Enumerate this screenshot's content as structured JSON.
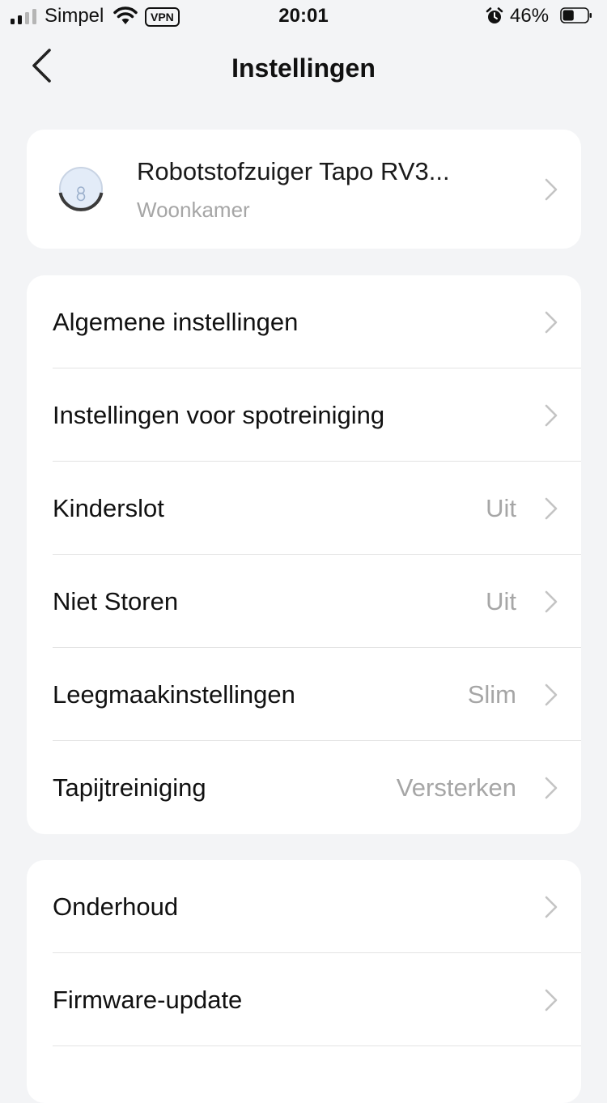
{
  "status_bar": {
    "carrier": "Simpel",
    "vpn": "VPN",
    "time": "20:01",
    "battery_percent": "46%",
    "battery_level": 0.46
  },
  "nav": {
    "title": "Instellingen",
    "back_icon": "chevron-left-icon"
  },
  "device": {
    "name": "Robotstofzuiger Tapo RV3...",
    "room": "Woonkamer",
    "icon": "robot-vacuum-icon"
  },
  "settings": [
    {
      "label": "Algemene instellingen",
      "value": ""
    },
    {
      "label": "Instellingen voor spotreiniging",
      "value": ""
    },
    {
      "label": "Kinderslot",
      "value": "Uit"
    },
    {
      "label": "Niet Storen",
      "value": "Uit"
    },
    {
      "label": "Leegmaakinstellingen",
      "value": "Slim"
    },
    {
      "label": "Tapijtreiniging",
      "value": "Versterken"
    }
  ],
  "maintenance": [
    {
      "label": "Onderhoud"
    },
    {
      "label": "Firmware-update"
    }
  ],
  "colors": {
    "background": "#f3f4f6",
    "card": "#ffffff",
    "secondary_text": "#a6a6a6",
    "chevron": "#c4c4c4"
  }
}
